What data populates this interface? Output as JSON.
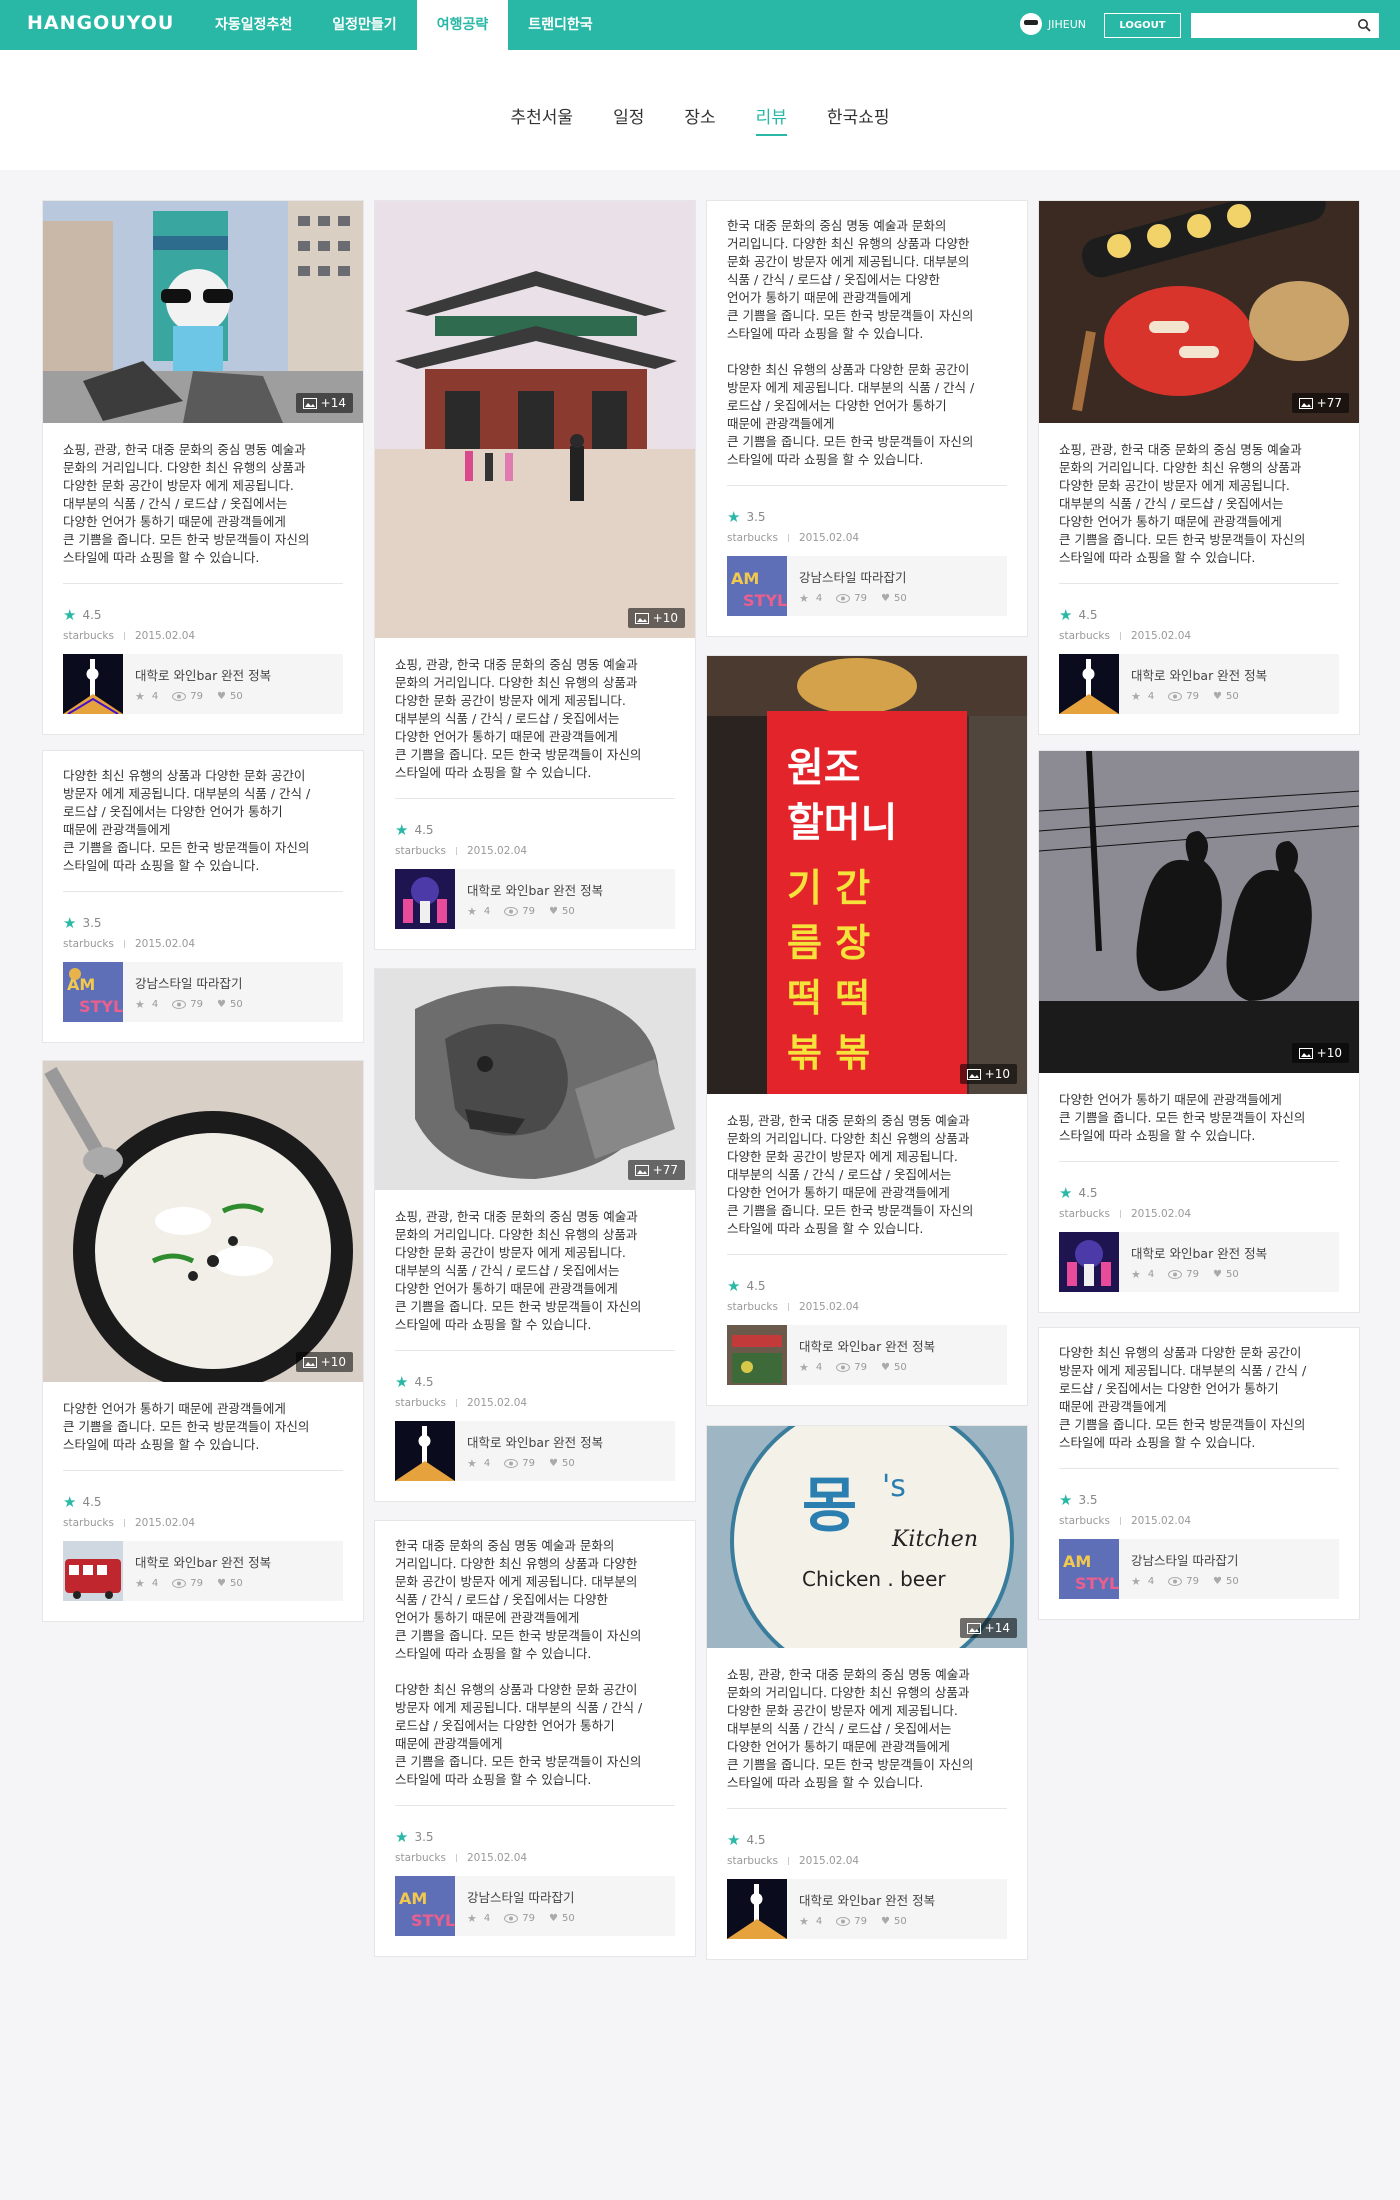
{
  "header": {
    "logo": "HANGOUYOU",
    "nav": [
      "자동일정추천",
      "일정만들기",
      "여행공략",
      "트랜디한국"
    ],
    "active_nav": "여행공략",
    "user_name": "JIHEUN",
    "logout_label": "LOGOUT",
    "search_placeholder": ""
  },
  "subnav": {
    "tabs": [
      "추천서울",
      "일정",
      "장소",
      "리뷰",
      "한국쇼핑"
    ],
    "active_tab": "리뷰"
  },
  "colors": {
    "accent": "#2ab8a6"
  },
  "cards": [
    {
      "badge": "+14",
      "desc": "쇼핑, 관광, 한국 대중 문화의 중심 명동 예술과\n문화의 거리입니다. 다양한 최신 유행의 상품과\n다양한 문화 공간이 방문자 에게 제공됩니다.\n대부분의 식품 / 간식 / 로드샵 / 옷집에서는\n다양한 언어가 통하기 때문에 관광객들에게\n큰 기쁨을 줍니다. 모든 한국 방문객들이 자신의\n스타일에 따라 쇼핑을 할 수 있습니다.",
      "rating": "4.5",
      "author": "starbucks",
      "date": "2015.02.04",
      "related_title": "대학로 와인bar 완전 정복",
      "stars": "4",
      "views": "79",
      "likes": "50"
    },
    {
      "badge": "",
      "desc": "다양한 최신 유행의 상품과 다양한 문화 공간이\n방문자 에게 제공됩니다. 대부분의 식품 / 간식 /\n로드샵 / 옷집에서는 다양한 언어가 통하기\n때문에 관광객들에게\n큰 기쁨을 줍니다. 모든 한국 방문객들이 자신의\n스타일에 따라 쇼핑을 할 수 있습니다.",
      "rating": "3.5",
      "author": "starbucks",
      "date": "2015.02.04",
      "related_title": "강남스타일 따라잡기",
      "stars": "4",
      "views": "79",
      "likes": "50"
    },
    {
      "badge": "+10",
      "desc": "다양한 언어가 통하기 때문에 관광객들에게\n큰 기쁨을 줍니다. 모든 한국 방문객들이 자신의\n스타일에 따라 쇼핑을 할 수 있습니다.",
      "rating": "4.5",
      "author": "starbucks",
      "date": "2015.02.04",
      "related_title": "대학로 와인bar 완전 정복",
      "stars": "4",
      "views": "79",
      "likes": "50"
    },
    {
      "badge": "+10",
      "desc": "쇼핑, 관광, 한국 대중 문화의 중심 명동 예술과\n문화의 거리입니다. 다양한 최신 유행의 상품과\n다양한 문화 공간이 방문자 에게 제공됩니다.\n대부분의 식품 / 간식 / 로드샵 / 옷집에서는\n다양한 언어가 통하기 때문에 관광객들에게\n큰 기쁨을 줍니다. 모든 한국 방문객들이 자신의\n스타일에 따라 쇼핑을 할 수 있습니다.",
      "rating": "4.5",
      "author": "starbucks",
      "date": "2015.02.04",
      "related_title": "대학로 와인bar 완전 정복",
      "stars": "4",
      "views": "79",
      "likes": "50"
    },
    {
      "badge": "+77",
      "desc": "쇼핑, 관광, 한국 대중 문화의 중심 명동 예술과\n문화의 거리입니다. 다양한 최신 유행의 상품과\n다양한 문화 공간이 방문자 에게 제공됩니다.\n대부분의 식품 / 간식 / 로드샵 / 옷집에서는\n다양한 언어가 통하기 때문에 관광객들에게\n큰 기쁨을 줍니다. 모든 한국 방문객들이 자신의\n스타일에 따라 쇼핑을 할 수 있습니다.",
      "rating": "4.5",
      "author": "starbucks",
      "date": "2015.02.04",
      "related_title": "대학로 와인bar 완전 정복",
      "stars": "4",
      "views": "79",
      "likes": "50"
    },
    {
      "badge": "",
      "desc": "한국 대중 문화의 중심 명동 예술과 문화의\n거리입니다. 다양한 최신 유행의 상품과 다양한\n문화 공간이 방문자 에게 제공됩니다. 대부분의\n식품 / 간식 / 로드샵 / 옷집에서는 다양한\n언어가 통하기 때문에 관광객들에게\n큰 기쁨을 줍니다. 모든 한국 방문객들이 자신의\n스타일에 따라 쇼핑을 할 수 있습니다.\n\n다양한 최신 유행의 상품과 다양한 문화 공간이\n방문자 에게 제공됩니다. 대부분의 식품 / 간식 /\n로드샵 / 옷집에서는 다양한 언어가 통하기\n때문에 관광객들에게\n큰 기쁨을 줍니다. 모든 한국 방문객들이 자신의\n스타일에 따라 쇼핑을 할 수 있습니다.",
      "rating": "3.5",
      "author": "starbucks",
      "date": "2015.02.04",
      "related_title": "강남스타일 따라잡기",
      "stars": "4",
      "views": "79",
      "likes": "50"
    },
    {
      "badge": "",
      "desc": "한국 대중 문화의 중심 명동 예술과 문화의\n거리입니다. 다양한 최신 유행의 상품과 다양한\n문화 공간이 방문자 에게 제공됩니다. 대부분의\n식품 / 간식 / 로드샵 / 옷집에서는 다양한\n언어가 통하기 때문에 관광객들에게\n큰 기쁨을 줍니다. 모든 한국 방문객들이 자신의\n스타일에 따라 쇼핑을 할 수 있습니다.\n\n다양한 최신 유행의 상품과 다양한 문화 공간이\n방문자 에게 제공됩니다. 대부분의 식품 / 간식 /\n로드샵 / 옷집에서는 다양한 언어가 통하기\n때문에 관광객들에게\n큰 기쁨을 줍니다. 모든 한국 방문객들이 자신의\n스타일에 따라 쇼핑을 할 수 있습니다.",
      "rating": "3.5",
      "author": "starbucks",
      "date": "2015.02.04",
      "related_title": "강남스타일 따라잡기",
      "stars": "4",
      "views": "79",
      "likes": "50"
    },
    {
      "badge": "+10",
      "desc": "쇼핑, 관광, 한국 대중 문화의 중심 명동 예술과\n문화의 거리입니다. 다양한 최신 유행의 상품과\n다양한 문화 공간이 방문자 에게 제공됩니다.\n대부분의 식품 / 간식 / 로드샵 / 옷집에서는\n다양한 언어가 통하기 때문에 관광객들에게\n큰 기쁨을 줍니다. 모든 한국 방문객들이 자신의\n스타일에 따라 쇼핑을 할 수 있습니다.",
      "rating": "4.5",
      "author": "starbucks",
      "date": "2015.02.04",
      "related_title": "대학로 와인bar 완전 정복",
      "stars": "4",
      "views": "79",
      "likes": "50"
    },
    {
      "badge": "+14",
      "desc": "쇼핑, 관광, 한국 대중 문화의 중심 명동 예술과\n문화의 거리입니다. 다양한 최신 유행의 상품과\n다양한 문화 공간이 방문자 에게 제공됩니다.\n대부분의 식품 / 간식 / 로드샵 / 옷집에서는\n다양한 언어가 통하기 때문에 관광객들에게\n큰 기쁨을 줍니다. 모든 한국 방문객들이 자신의\n스타일에 따라 쇼핑을 할 수 있습니다.",
      "rating": "4.5",
      "author": "starbucks",
      "date": "2015.02.04",
      "related_title": "대학로 와인bar 완전 정복",
      "stars": "4",
      "views": "79",
      "likes": "50"
    },
    {
      "badge": "+77",
      "desc": "쇼핑, 관광, 한국 대중 문화의 중심 명동 예술과\n문화의 거리입니다. 다양한 최신 유행의 상품과\n다양한 문화 공간이 방문자 에게 제공됩니다.\n대부분의 식품 / 간식 / 로드샵 / 옷집에서는\n다양한 언어가 통하기 때문에 관광객들에게\n큰 기쁨을 줍니다. 모든 한국 방문객들이 자신의\n스타일에 따라 쇼핑을 할 수 있습니다.",
      "rating": "4.5",
      "author": "starbucks",
      "date": "2015.02.04",
      "related_title": "대학로 와인bar 완전 정복",
      "stars": "4",
      "views": "79",
      "likes": "50"
    },
    {
      "badge": "+10",
      "desc": "다양한 언어가 통하기 때문에 관광객들에게\n큰 기쁨을 줍니다. 모든 한국 방문객들이 자신의\n스타일에 따라 쇼핑을 할 수 있습니다.",
      "rating": "4.5",
      "author": "starbucks",
      "date": "2015.02.04",
      "related_title": "대학로 와인bar 완전 정복",
      "stars": "4",
      "views": "79",
      "likes": "50"
    },
    {
      "badge": "",
      "desc": "다양한 최신 유행의 상품과 다양한 문화 공간이\n방문자 에게 제공됩니다. 대부분의 식품 / 간식 /\n로드샵 / 옷집에서는 다양한 언어가 통하기\n때문에 관광객들에게\n큰 기쁨을 줍니다. 모든 한국 방문객들이 자신의\n스타일에 따라 쇼핑을 할 수 있습니다.",
      "rating": "3.5",
      "author": "starbucks",
      "date": "2015.02.04",
      "related_title": "강남스타일 따라잡기",
      "stars": "4",
      "views": "79",
      "likes": "50"
    }
  ]
}
